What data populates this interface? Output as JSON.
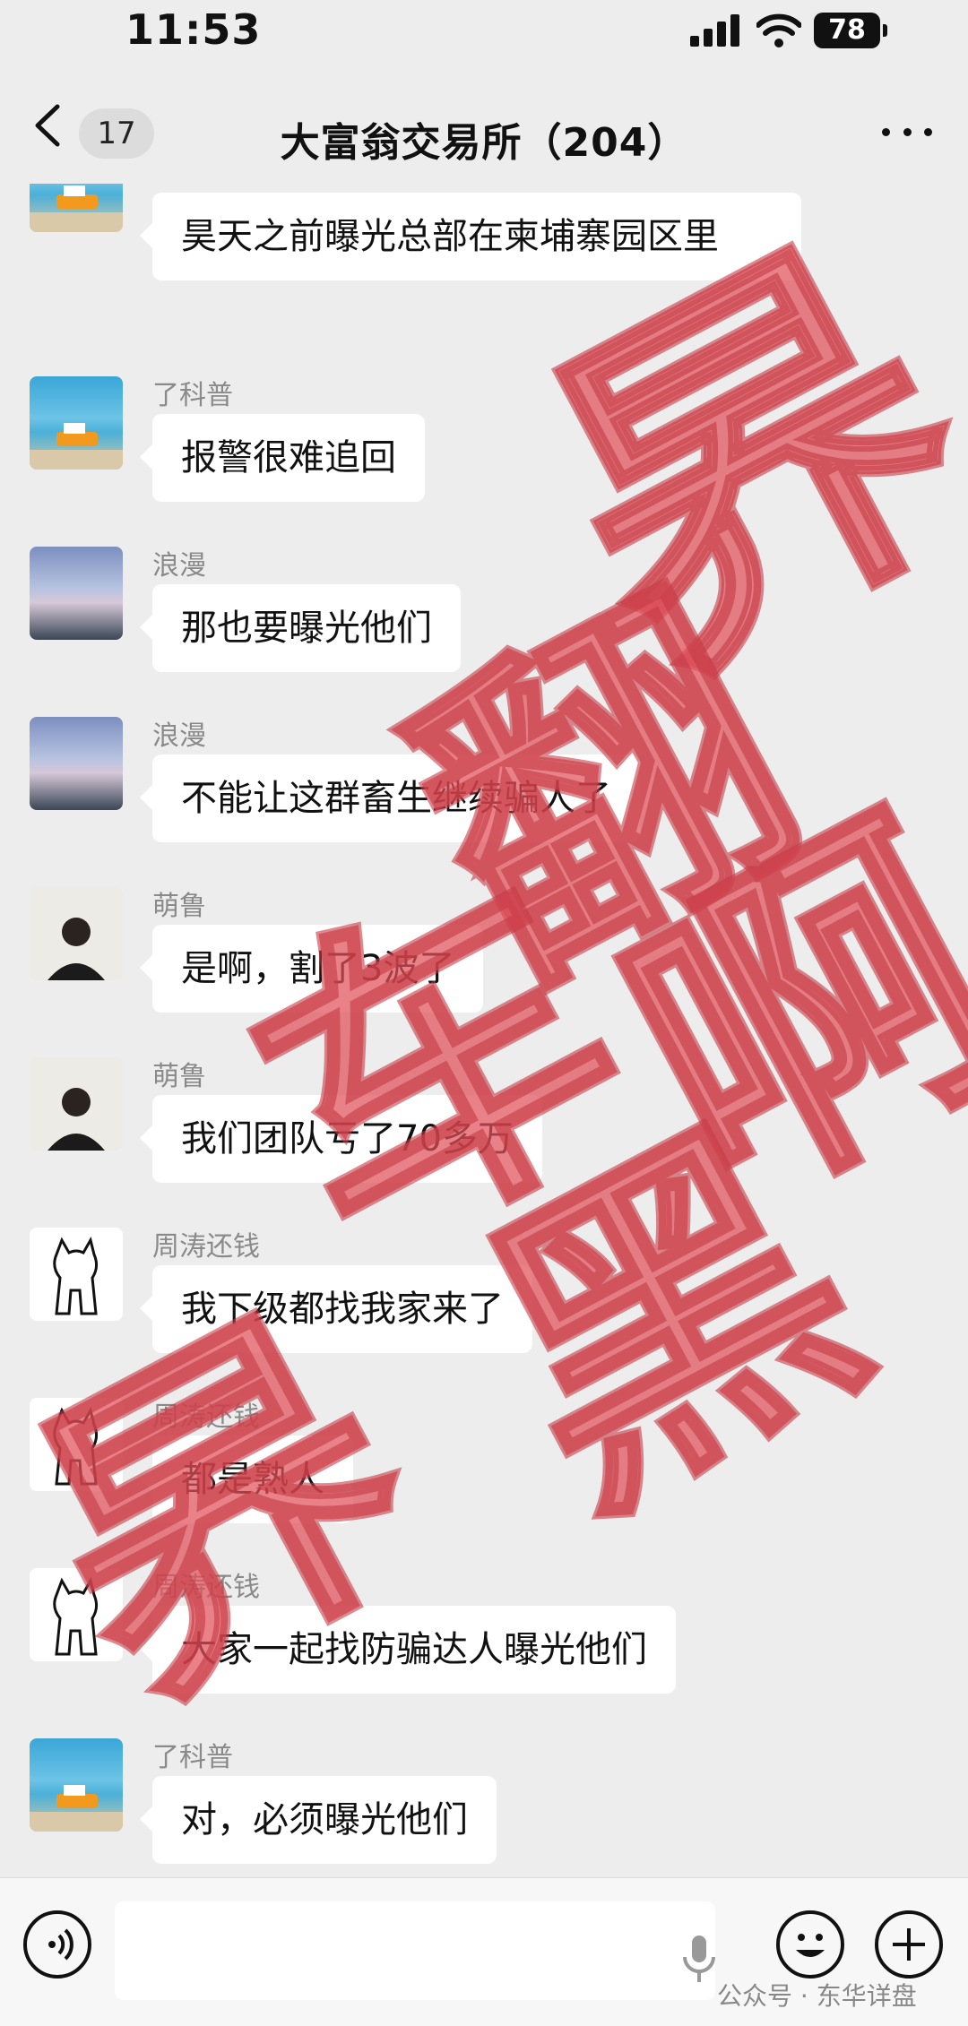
{
  "status": {
    "time": "11:53",
    "battery": "78"
  },
  "header": {
    "unread": "17",
    "title": "大富翁交易所（204）"
  },
  "messages": [
    {
      "sender": "",
      "text": "昊天之前曝光总部在柬埔寨园区里",
      "avatar": "boat-avatar"
    },
    {
      "sender": "了科普",
      "text": "报警很难追回",
      "avatar": "boat-avatar"
    },
    {
      "sender": "浪漫",
      "text": "那也要曝光他们",
      "avatar": "sky-avatar"
    },
    {
      "sender": "浪漫",
      "text": "不能让这群畜生继续骗人了",
      "avatar": "sky-avatar"
    },
    {
      "sender": "萌鲁",
      "text": "是啊，割了3波了",
      "avatar": "man-avatar"
    },
    {
      "sender": "萌鲁",
      "text": "我们团队亏了70多万",
      "avatar": "man-avatar"
    },
    {
      "sender": "周涛还钱",
      "text": "我下级都找我家来了",
      "avatar": "cat-avatar"
    },
    {
      "sender": "周涛还钱",
      "text": "都是熟人",
      "avatar": "cat-avatar"
    },
    {
      "sender": "周涛还钱",
      "text": "大家一起找防骗达人曝光他们",
      "avatar": "cat-avatar"
    },
    {
      "sender": "了科普",
      "text": "对，必须曝光他们",
      "avatar": "boat-avatar"
    }
  ],
  "watermark": "公众号 · 东华详盘",
  "stamp_text": [
    "昦",
    "翻",
    "车",
    "啊",
    "黑",
    "昦"
  ],
  "colors": {
    "stamp": "#e0505a",
    "background": "#ededed",
    "bubble": "#ffffff"
  }
}
